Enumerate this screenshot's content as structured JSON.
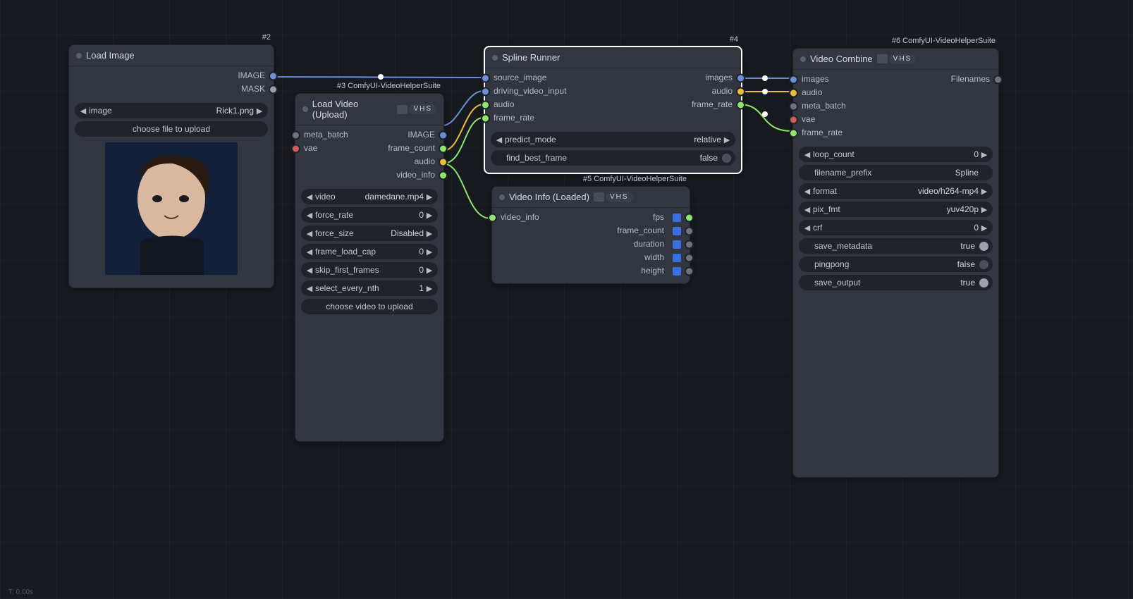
{
  "footer": "T: 0.00s",
  "nodes": {
    "load_image": {
      "tag": "#2",
      "title": "Load Image",
      "outputs": {
        "image": "IMAGE",
        "mask": "MASK"
      },
      "widgets": {
        "image": {
          "label": "image",
          "value": "Rick1.png"
        },
        "choose": "choose file to upload"
      }
    },
    "load_video": {
      "tag": "#3 ComfyUI-VideoHelperSuite",
      "pill_caps": "VHS",
      "title": "Load Video (Upload)",
      "inputs": {
        "meta_batch": "meta_batch",
        "vae": "vae"
      },
      "outputs": {
        "image": "IMAGE",
        "frame_count": "frame_count",
        "audio": "audio",
        "video_info": "video_info"
      },
      "widgets": {
        "video": {
          "label": "video",
          "value": "damedane.mp4"
        },
        "force_rate": {
          "label": "force_rate",
          "value": "0"
        },
        "force_size": {
          "label": "force_size",
          "value": "Disabled"
        },
        "frame_load_cap": {
          "label": "frame_load_cap",
          "value": "0"
        },
        "skip_first_frames": {
          "label": "skip_first_frames",
          "value": "0"
        },
        "select_every_nth": {
          "label": "select_every_nth",
          "value": "1"
        },
        "choose": "choose video to upload"
      }
    },
    "spline_runner": {
      "tag": "#4",
      "title": "Spline Runner",
      "inputs": {
        "source_image": "source_image",
        "driving_video_input": "driving_video_input",
        "audio": "audio",
        "frame_rate": "frame_rate"
      },
      "outputs": {
        "images": "images",
        "audio": "audio",
        "frame_rate": "frame_rate"
      },
      "widgets": {
        "predict_mode": {
          "label": "predict_mode",
          "value": "relative"
        },
        "find_best_frame": {
          "label": "find_best_frame",
          "value": "false"
        }
      }
    },
    "video_info": {
      "tag": "#5 ComfyUI-VideoHelperSuite",
      "pill_caps": "VHS",
      "title": "Video Info (Loaded)",
      "inputs": {
        "video_info": "video_info"
      },
      "outputs": {
        "fps": "fps",
        "frame_count": "frame_count",
        "duration": "duration",
        "width": "width",
        "height": "height"
      }
    },
    "video_combine": {
      "tag": "#6 ComfyUI-VideoHelperSuite",
      "pill_caps": "VHS",
      "title": "Video Combine",
      "inputs": {
        "images": "images",
        "audio": "audio",
        "meta_batch": "meta_batch",
        "vae": "vae",
        "frame_rate": "frame_rate"
      },
      "outputs": {
        "filenames": "Filenames"
      },
      "widgets": {
        "loop_count": {
          "label": "loop_count",
          "value": "0"
        },
        "filename_prefix": {
          "label": "filename_prefix",
          "value": "Spline"
        },
        "format": {
          "label": "format",
          "value": "video/h264-mp4"
        },
        "pix_fmt": {
          "label": "pix_fmt",
          "value": "yuv420p"
        },
        "crf": {
          "label": "crf",
          "value": "0"
        },
        "save_metadata": {
          "label": "save_metadata",
          "value": "true"
        },
        "pingpong": {
          "label": "pingpong",
          "value": "false"
        },
        "save_output": {
          "label": "save_output",
          "value": "true"
        }
      }
    }
  },
  "colors": {
    "image": "#6e8fd6",
    "mask": "#9aa0ab",
    "num": "#8ee66a",
    "audio": "#e9bc3a",
    "purple": "#a87ce0",
    "grey": "#6f737e",
    "red": "#d45a5a",
    "blue_fill": "#3a6fe0"
  }
}
